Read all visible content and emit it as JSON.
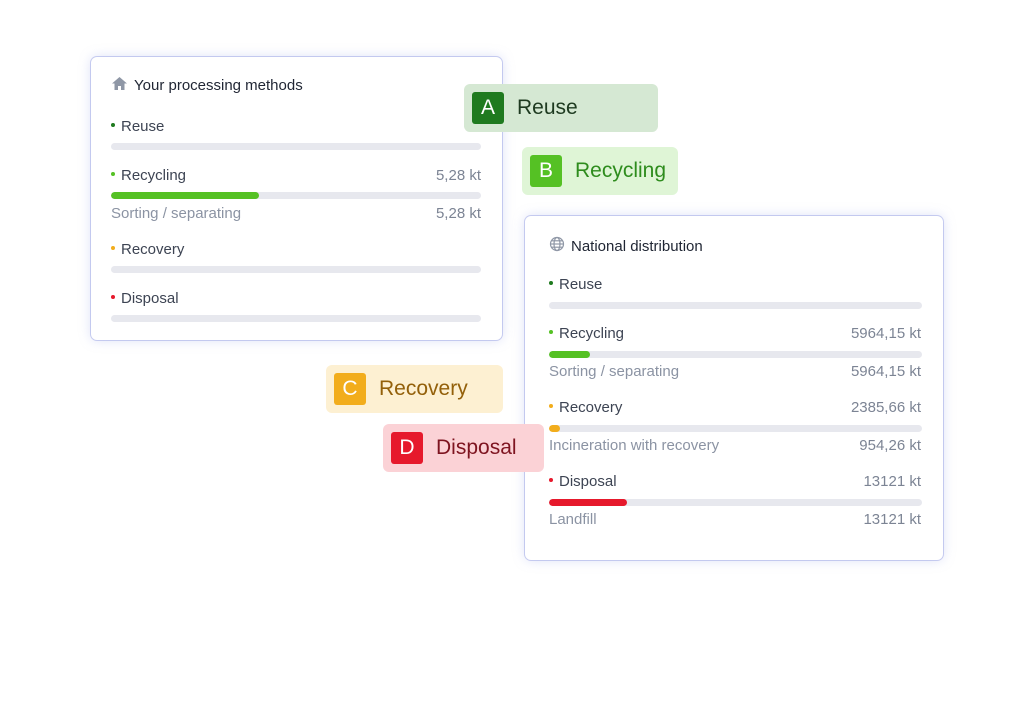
{
  "colors": {
    "reuse": "#1f7a1f",
    "recycling": "#55c124",
    "recovery": "#f2ad1c",
    "disposal": "#e6192c",
    "track": "#e7e8ee"
  },
  "left_card": {
    "icon": "home-icon",
    "title": "Your processing methods",
    "reuse": {
      "label": "Reuse",
      "fill_fraction": 0
    },
    "recycling": {
      "label": "Recycling",
      "value": "5,28 kt",
      "fill_fraction": 0.4
    },
    "recycling_sub": {
      "label": "Sorting / separating",
      "value": "5,28 kt"
    },
    "recovery": {
      "label": "Recovery",
      "fill_fraction": 0
    },
    "disposal": {
      "label": "Disposal",
      "fill_fraction": 0
    }
  },
  "right_card": {
    "icon": "globe-icon",
    "title": "National distribution",
    "reuse": {
      "label": "Reuse",
      "fill_fraction": 0
    },
    "recycling": {
      "label": "Recycling",
      "value": "5964,15 kt",
      "fill_fraction": 0.11
    },
    "recycling_sub": {
      "label": "Sorting / separating",
      "value": "5964,15 kt"
    },
    "recovery": {
      "label": "Recovery",
      "value": "2385,66 kt",
      "fill_fraction": 0.03
    },
    "recovery_sub": {
      "label": "Incineration with recovery",
      "value": "954,26 kt"
    },
    "disposal": {
      "label": "Disposal",
      "value": "13121 kt",
      "fill_fraction": 0.21
    },
    "disposal_sub": {
      "label": "Landfill",
      "value": "13121 kt"
    }
  },
  "tags": {
    "a": {
      "letter": "A",
      "label": "Reuse"
    },
    "b": {
      "letter": "B",
      "label": "Recycling"
    },
    "c": {
      "letter": "C",
      "label": "Recovery"
    },
    "d": {
      "letter": "D",
      "label": "Disposal"
    }
  }
}
